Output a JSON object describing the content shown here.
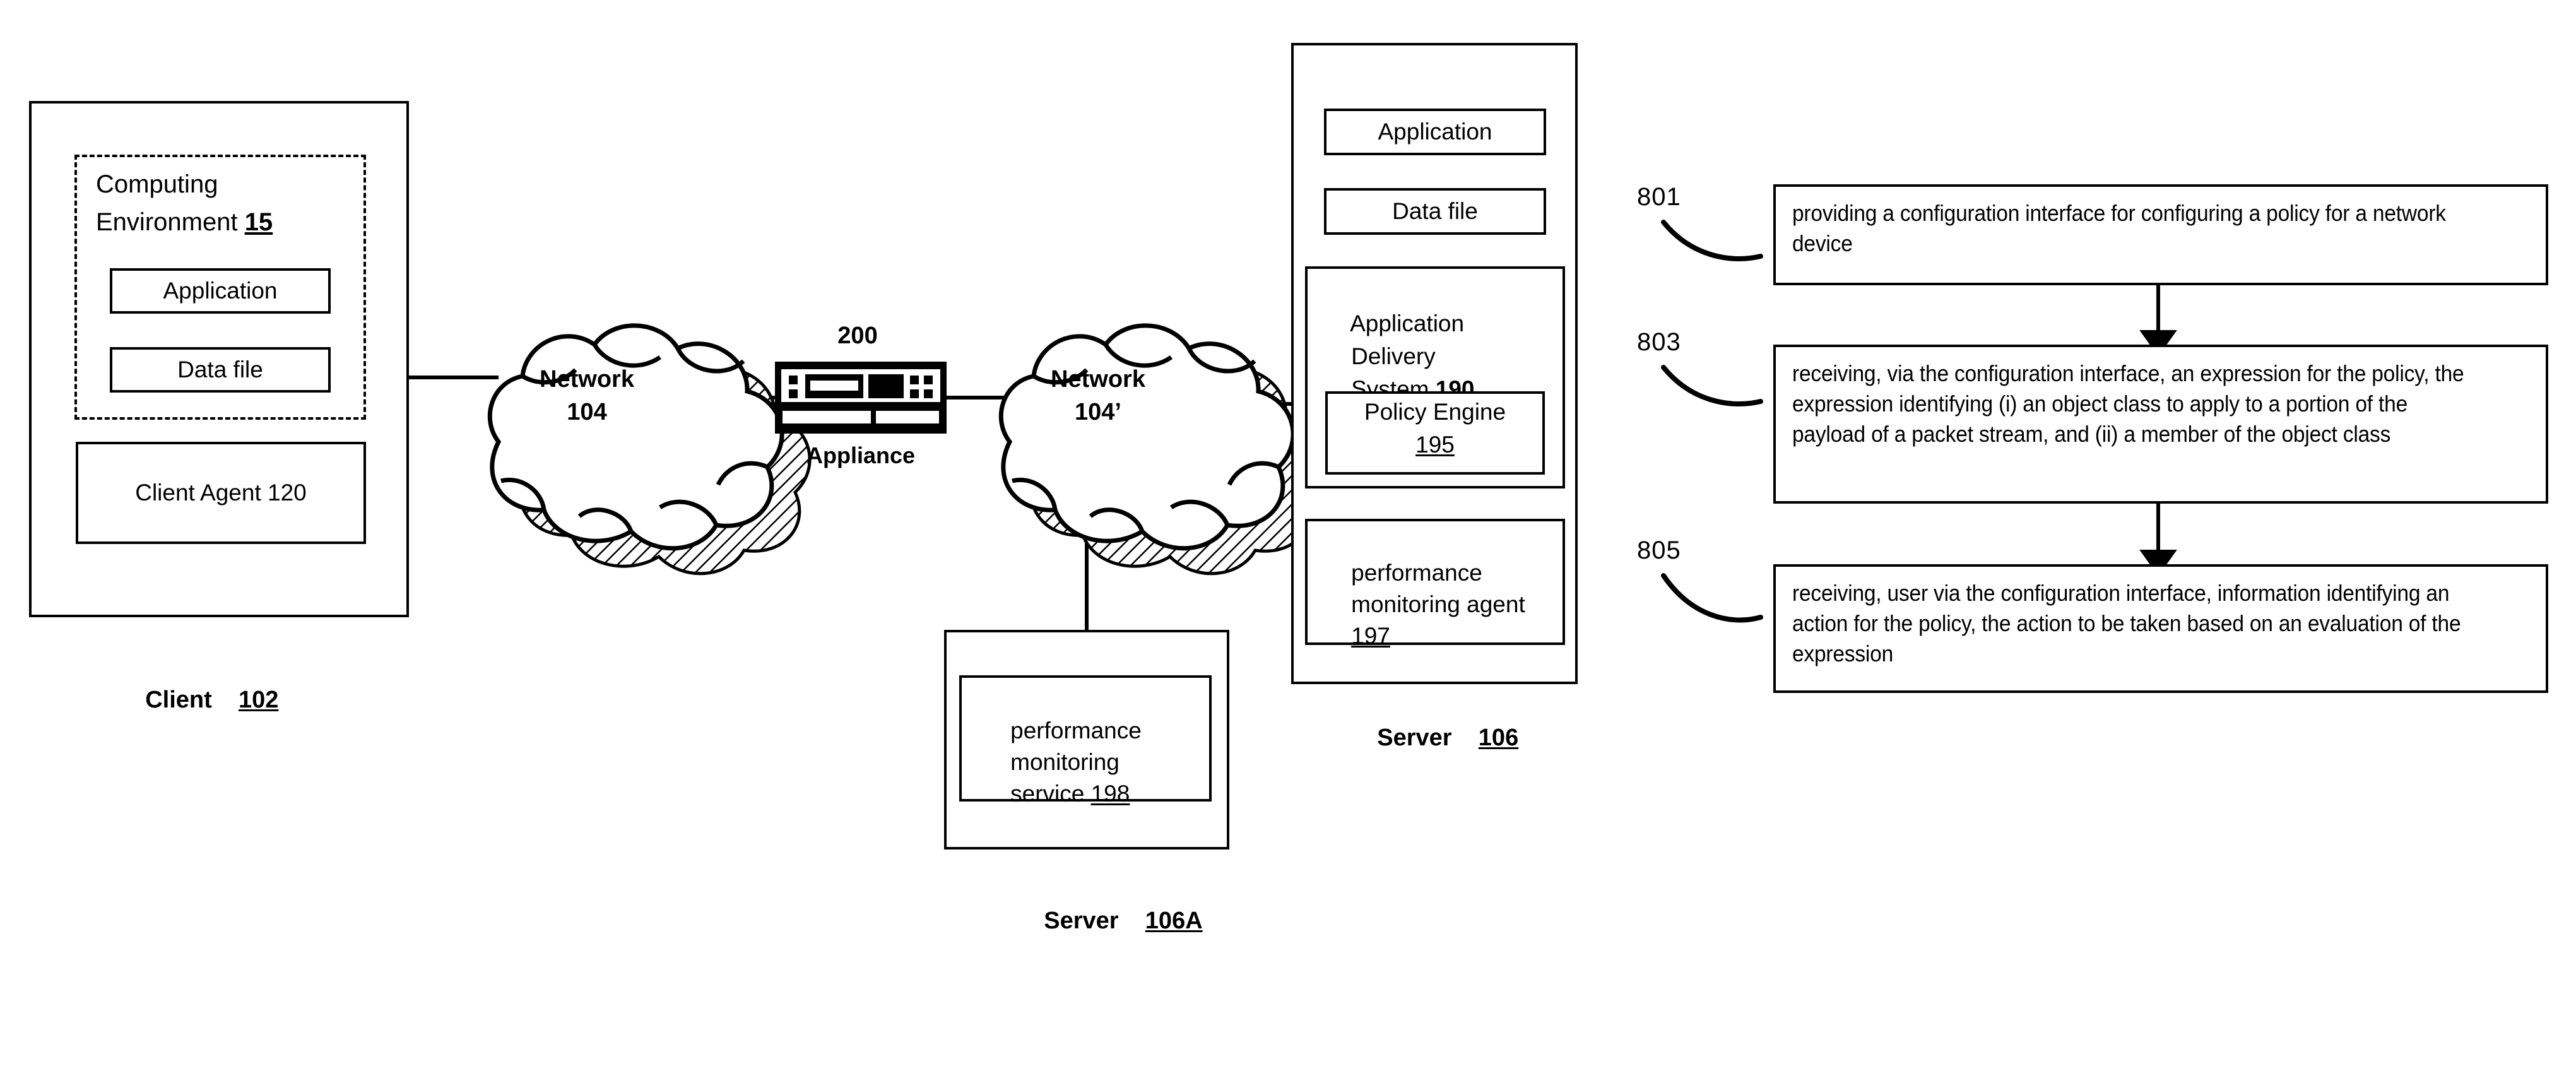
{
  "figure": {
    "type": "patent-figure",
    "left_diagram": "network architecture with client, appliance, networks and servers",
    "right_diagram": "method flowchart"
  },
  "client": {
    "box_label": "Client",
    "box_ref": "102",
    "computing_environment": {
      "title_line1": "Computing",
      "title_line2": "Environment",
      "ref": "15",
      "application": "Application",
      "data_file": "Data file"
    },
    "client_agent": "Client Agent 120"
  },
  "network_1": {
    "name": "Network",
    "ref": "104"
  },
  "network_2": {
    "name": "Network",
    "ref": "104’"
  },
  "appliance": {
    "ref": "200",
    "label": "Appliance",
    "icon": "appliance-device-icon"
  },
  "server_106": {
    "box_label": "Server",
    "box_ref": "106",
    "application": "Application",
    "data_file": "Data file",
    "ads": {
      "line1": "Application",
      "line2": "Delivery",
      "line3": "System",
      "ref": "190",
      "policy_engine": {
        "name": "Policy Engine",
        "ref": "195"
      }
    },
    "perf_agent": {
      "line1": "performance",
      "line2": "monitoring agent",
      "ref": "197"
    }
  },
  "server_106a": {
    "box_label": "Server",
    "box_ref": "106A",
    "perf_service": {
      "line1": "performance",
      "line2": "monitoring",
      "line3": "service",
      "ref": "198"
    }
  },
  "flowchart": {
    "steps": [
      {
        "ref": "801",
        "text": "providing a configuration interface for configuring a policy for a network device"
      },
      {
        "ref": "803",
        "text": "receiving, via the configuration interface, an expression for the policy, the expression identifying (i) an object class to apply to a portion of the payload of a packet stream, and (ii) a member of the object class"
      },
      {
        "ref": "805",
        "text": "receiving, user via the configuration interface, information identifying an action for the policy, the action to be taken based on an evaluation of the expression"
      }
    ]
  },
  "colors": {
    "ink": "#000000",
    "paper": "#ffffff"
  }
}
